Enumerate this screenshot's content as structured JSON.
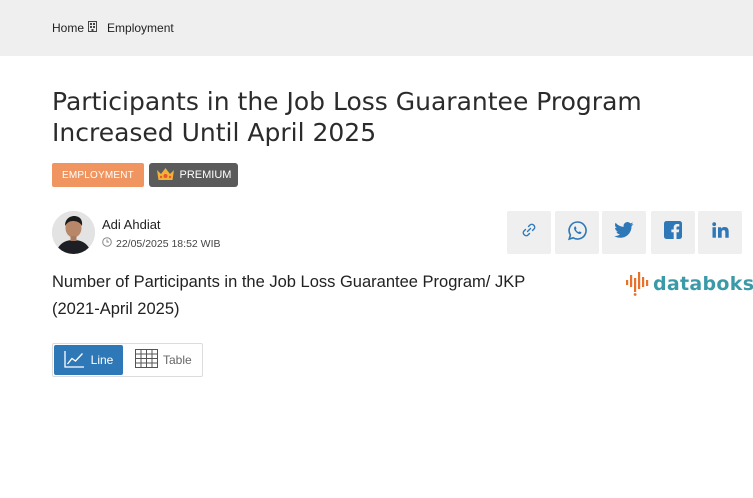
{
  "breadcrumb": {
    "home": "Home",
    "section": "Employment"
  },
  "article": {
    "title": "Participants in the Job Loss Guarantee Program Increased Until April 2025",
    "category_tag": "EMPLOYMENT",
    "premium_tag": "PREMIUM",
    "author": "Adi Ahdiat",
    "date": "22/05/2025 18:52 WIB"
  },
  "share": {
    "icons": [
      "link-icon",
      "whatsapp-icon",
      "twitter-icon",
      "facebook-icon",
      "linkedin-icon"
    ]
  },
  "chart": {
    "title": "Number of Participants in the Job Loss Guarantee Program/ JKP (2021-April 2025)",
    "brand": "databoks",
    "view_toggle": {
      "line_label": "Line",
      "table_label": "Table",
      "active": "Line"
    }
  },
  "colors": {
    "topbar": "#efefef",
    "employment_tag": "#f0955f",
    "premium_tag": "#5b5b5b",
    "toggle_active": "#2f78b7",
    "brand_teal": "#3b9aa8",
    "brand_orange": "#e8702a"
  }
}
